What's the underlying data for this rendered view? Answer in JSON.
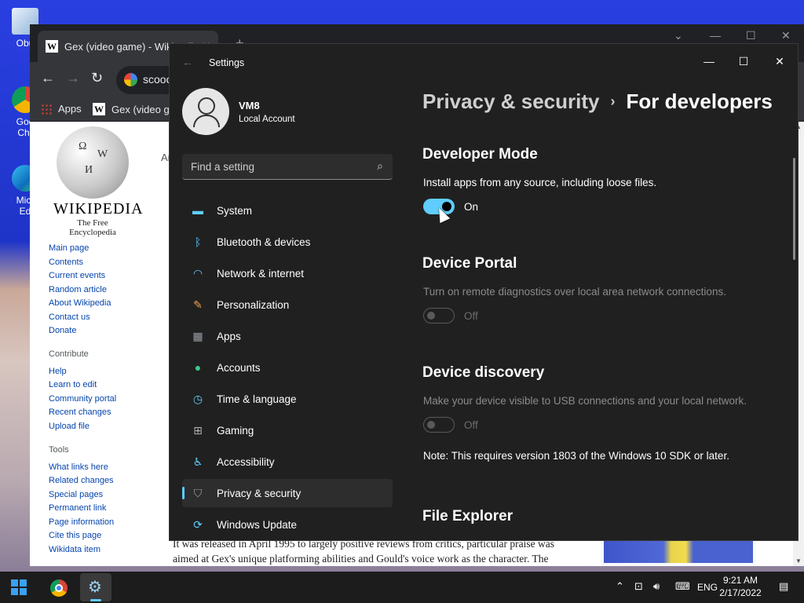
{
  "desktop": {
    "icons": [
      {
        "label": "Obu"
      },
      {
        "label": "Goo Chr"
      },
      {
        "label": "Micr Ed"
      }
    ]
  },
  "chrome": {
    "tab_title": "Gex (video game) - Wikipedia",
    "omnibox_text": "scooo",
    "bookmarks": {
      "apps": "Apps",
      "wiki": "Gex (video ga"
    }
  },
  "wikipedia": {
    "wordmark": "WIKIPEDIA",
    "tagline": "The Free Encyclopedia",
    "nav_main": [
      "Main page",
      "Contents",
      "Current events",
      "Random article",
      "About Wikipedia",
      "Contact us",
      "Donate"
    ],
    "contribute_header": "Contribute",
    "nav_contribute": [
      "Help",
      "Learn to edit",
      "Community portal",
      "Recent changes",
      "Upload file"
    ],
    "tools_header": "Tools",
    "nav_tools": [
      "What links here",
      "Related changes",
      "Special pages",
      "Permanent link",
      "Page information",
      "Cite this page",
      "Wikidata item"
    ],
    "article_partial": "An",
    "body_line1": "It was released in April 1995 to largely positive reviews from critics, particular praise was",
    "body_line2": "aimed at Gex's unique platforming abilities and Gould's voice work as the character. The"
  },
  "settings": {
    "window_title": "Settings",
    "profile": {
      "name": "VM8",
      "account_type": "Local Account"
    },
    "search_placeholder": "Find a setting",
    "nav": [
      {
        "label": "System",
        "icon": "monitor-icon",
        "color": "#60cdff"
      },
      {
        "label": "Bluetooth & devices",
        "icon": "bluetooth-icon",
        "color": "#60cdff"
      },
      {
        "label": "Network & internet",
        "icon": "wifi-icon",
        "color": "#60cdff"
      },
      {
        "label": "Personalization",
        "icon": "brush-icon",
        "color": "#f0a050"
      },
      {
        "label": "Apps",
        "icon": "apps-icon",
        "color": "#9aa0a6"
      },
      {
        "label": "Accounts",
        "icon": "person-icon",
        "color": "#3ec98a"
      },
      {
        "label": "Time & language",
        "icon": "globe-clock-icon",
        "color": "#60cdff"
      },
      {
        "label": "Gaming",
        "icon": "gamepad-icon",
        "color": "#b0b0b0"
      },
      {
        "label": "Accessibility",
        "icon": "accessibility-icon",
        "color": "#60cdff"
      },
      {
        "label": "Privacy & security",
        "icon": "shield-icon",
        "color": "#9aa0a6",
        "active": true
      },
      {
        "label": "Windows Update",
        "icon": "update-icon",
        "color": "#60cdff"
      }
    ],
    "breadcrumb": {
      "parent": "Privacy & security",
      "separator": "›",
      "current": "For developers"
    },
    "sections": {
      "developer_mode": {
        "title": "Developer Mode",
        "description": "Install apps from any source, including loose files.",
        "state": "On"
      },
      "device_portal": {
        "title": "Device Portal",
        "description": "Turn on remote diagnostics over local area network connections.",
        "state": "Off"
      },
      "device_discovery": {
        "title": "Device discovery",
        "description": "Make your device visible to USB connections and your local network.",
        "state": "Off",
        "note": "Note: This requires version 1803 of the Windows 10 SDK or later."
      },
      "file_explorer": {
        "title": "File Explorer"
      }
    },
    "accent_color": "#60cdff"
  },
  "taskbar": {
    "language": "ENG",
    "time": "9:21 AM",
    "date": "2/17/2022"
  }
}
